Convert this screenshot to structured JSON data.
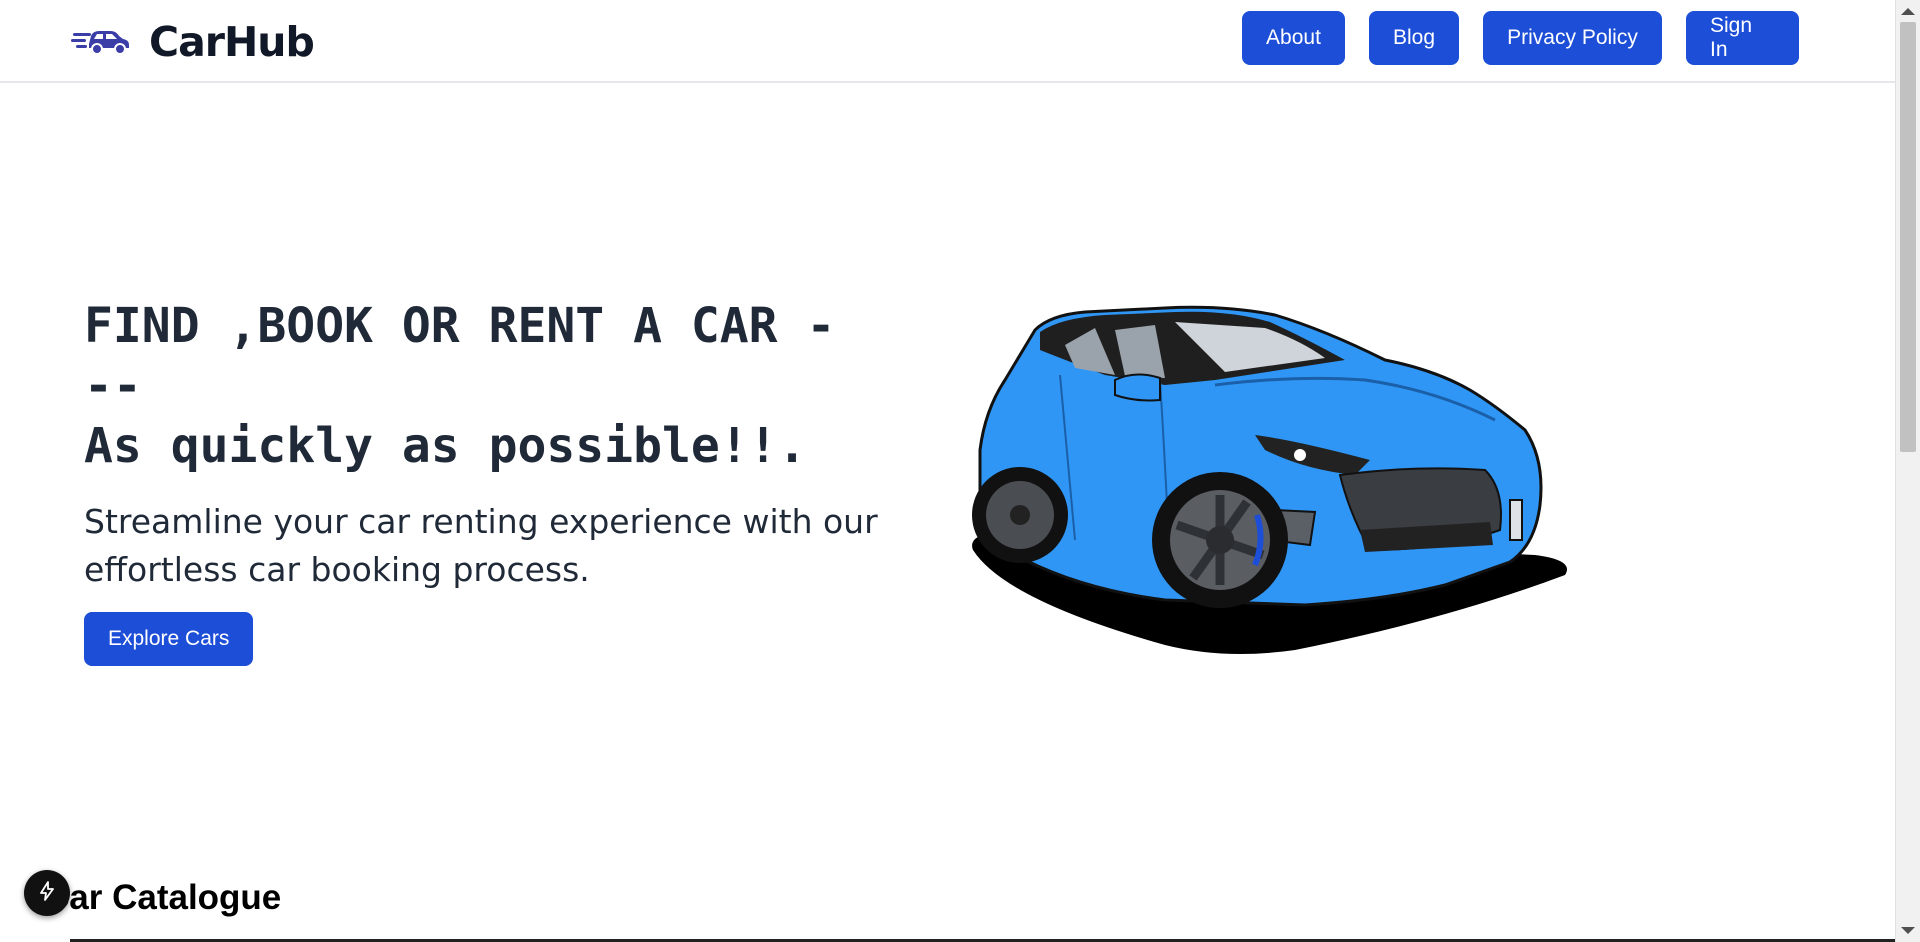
{
  "brand": {
    "name": "CarHub",
    "icon": "car-speed-icon"
  },
  "nav": {
    "items": [
      {
        "label": "About"
      },
      {
        "label": "Blog"
      },
      {
        "label": "Privacy Policy"
      },
      {
        "label": "Sign In"
      }
    ]
  },
  "hero": {
    "title_line1": "FIND ,BOOK OR RENT A CAR -\n--",
    "title_line2": "As quickly as possible!!.",
    "subtitle": "Streamline your car renting experience with our effortless car booking process.",
    "cta_label": "Explore Cars",
    "image": "blue-hatchback-car-illustration"
  },
  "catalogue": {
    "title": "Car Catalogue"
  },
  "dev_badge": {
    "icon": "lightning-icon"
  },
  "colors": {
    "accent": "#1d4ed8",
    "car_blue": "#2f96f5",
    "text": "#1f2937"
  }
}
